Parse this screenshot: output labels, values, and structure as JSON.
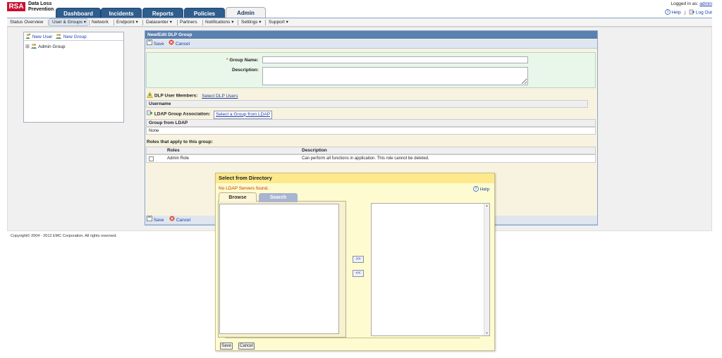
{
  "header": {
    "logo": "RSA",
    "product_line1": "Data Loss",
    "product_line2": "Prevention",
    "logged_in_prefix": "Logged in as:",
    "logged_in_user": "admin",
    "help": "Help",
    "separator": "|",
    "logout": "Log Out"
  },
  "tabs": [
    {
      "label": "Dashboard"
    },
    {
      "label": "Incidents"
    },
    {
      "label": "Reports"
    },
    {
      "label": "Policies"
    },
    {
      "label": "Admin"
    }
  ],
  "subnav": [
    {
      "label": "Status Overview"
    },
    {
      "label": "User & Groups ▾"
    },
    {
      "label": "Network"
    },
    {
      "label": "Endpoint ▾"
    },
    {
      "label": "Datacenter ▾"
    },
    {
      "label": "Partners"
    },
    {
      "label": "Notifications ▾"
    },
    {
      "label": "Settings ▾"
    },
    {
      "label": "Support ▾"
    }
  ],
  "left_panel": {
    "new_user": "New User",
    "new_group": "New Group",
    "tree_expander": "⊞",
    "tree_item": "Admin Group"
  },
  "main": {
    "title": "New/Edit DLP Group",
    "save": "Save",
    "cancel": "Cancel",
    "required_mark": "*",
    "group_name_label": "Group Name:",
    "group_name_value": "",
    "description_label": "Description:",
    "description_value": "",
    "dlp_members_label": "DLP User Members:",
    "select_dlp_users": "Select DLP Users",
    "username_header": "Username",
    "ldap_label": "LDAP Group Association:",
    "select_ldap_group": "Select a Group from LDAP",
    "group_from_ldap_header": "Group from LDAP",
    "group_from_ldap_value": "None",
    "roles_heading": "Roles that apply to this group:",
    "roles_col_roles": "Roles",
    "roles_col_description": "Description",
    "roles": [
      {
        "name": "Admin Role",
        "description": "Can perform all functions in application. This role cannot be deleted."
      }
    ]
  },
  "footer": {
    "copyright": "Copyright© 2004 - 2012 EMC Corporation. All rights reserved."
  },
  "dialog": {
    "title": "Select from Directory",
    "message": "No LDAP Servers found.",
    "help": "Help",
    "tab_browse": "Browse",
    "tab_search": "Search",
    "add": ">>",
    "remove": "<<",
    "save": "Save",
    "cancel": "Cancel"
  },
  "colors": {
    "tab_blue": "#2f5d8c",
    "title_bar": "#5a80b0",
    "form_green": "#e9f6ea",
    "dialog_yellow": "#fffbd0",
    "dialog_title": "#fde98c",
    "error_text": "#c23a00",
    "link": "#1a3fa8",
    "logo_red": "#c8102e"
  }
}
